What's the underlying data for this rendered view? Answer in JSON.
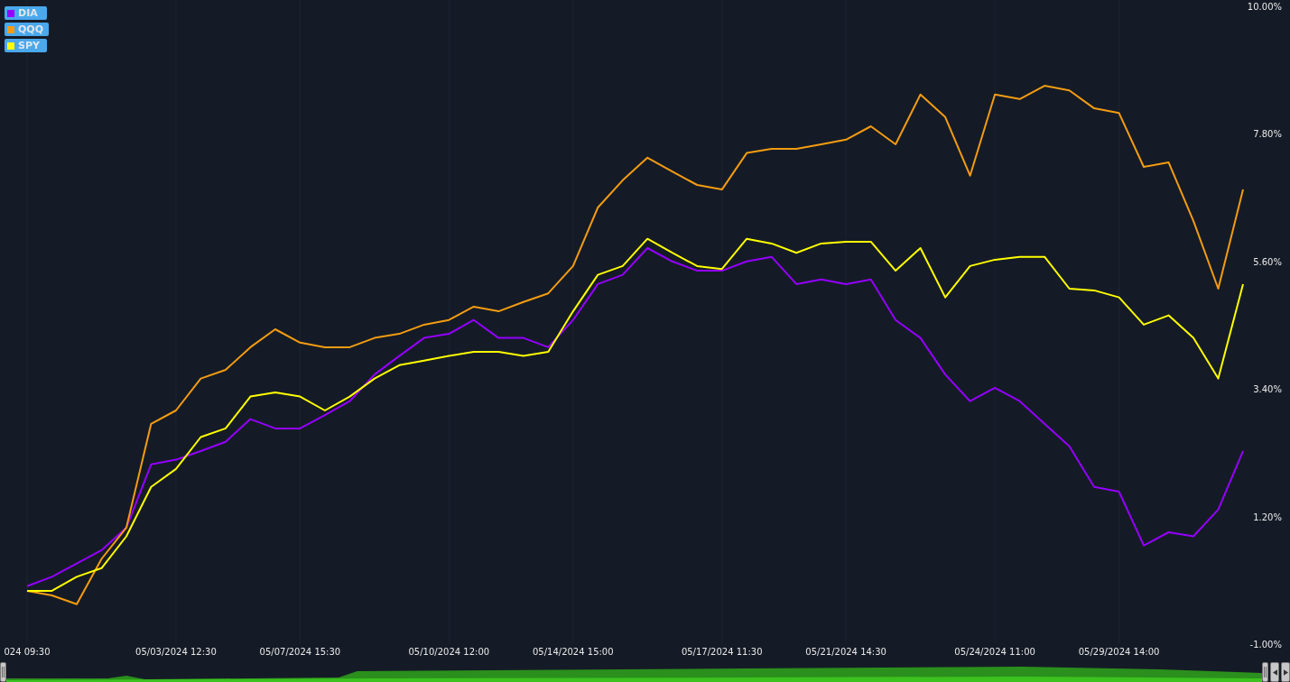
{
  "chart_data": {
    "type": "line",
    "grid": true,
    "ylim": [
      -1,
      10
    ],
    "categories": [
      "024 09:30",
      null,
      null,
      null,
      null,
      null,
      "05/03/2024 12:30",
      null,
      null,
      null,
      null,
      "05/07/2024 15:30",
      null,
      null,
      null,
      null,
      null,
      "05/10/2024 12:00",
      null,
      null,
      null,
      null,
      "05/14/2024 15:00",
      null,
      null,
      null,
      null,
      null,
      "05/17/2024 11:30",
      null,
      null,
      null,
      null,
      "05/21/2024 14:30",
      null,
      null,
      null,
      null,
      null,
      "05/24/2024 11:00",
      null,
      null,
      null,
      null,
      "05/29/2024 14:00",
      null,
      null,
      null,
      null,
      null
    ],
    "yticks": [
      {
        "value": -1,
        "label": "-1.00%"
      },
      {
        "value": 1.2,
        "label": "1.20%"
      },
      {
        "value": 3.4,
        "label": "3.40%"
      },
      {
        "value": 5.6,
        "label": "5.60%"
      },
      {
        "value": 7.8,
        "label": "7.80%"
      },
      {
        "value": 10,
        "label": "10.00%"
      }
    ],
    "series": [
      {
        "name": "DIA",
        "color": "#9400ff",
        "values": [
          0.0,
          0.16,
          0.39,
          0.62,
          1.01,
          2.1,
          2.18,
          2.33,
          2.49,
          2.88,
          2.72,
          2.72,
          2.95,
          3.19,
          3.65,
          3.97,
          4.28,
          4.35,
          4.59,
          4.28,
          4.28,
          4.12,
          4.59,
          5.21,
          5.37,
          5.83,
          5.6,
          5.44,
          5.44,
          5.6,
          5.68,
          5.21,
          5.29,
          5.21,
          5.29,
          4.59,
          4.28,
          3.65,
          3.19,
          3.42,
          3.19,
          2.8,
          2.41,
          1.71,
          1.63,
          0.7,
          0.93,
          0.86,
          1.32,
          2.33
        ]
      },
      {
        "name": "QQQ",
        "color": "#f39c12",
        "values": [
          -0.08,
          -0.16,
          -0.31,
          0.47,
          1.01,
          2.8,
          3.03,
          3.58,
          3.73,
          4.12,
          4.43,
          4.2,
          4.12,
          4.12,
          4.28,
          4.35,
          4.51,
          4.59,
          4.82,
          4.74,
          4.9,
          5.05,
          5.52,
          6.53,
          7.0,
          7.39,
          7.15,
          6.92,
          6.84,
          7.47,
          7.54,
          7.54,
          7.62,
          7.7,
          7.93,
          7.62,
          8.48,
          8.09,
          7.08,
          8.48,
          8.4,
          8.63,
          8.55,
          8.24,
          8.16,
          7.23,
          7.31,
          6.3,
          5.13,
          6.84
        ]
      },
      {
        "name": "SPY",
        "color": "#ffff00",
        "values": [
          -0.08,
          -0.08,
          0.16,
          0.31,
          0.86,
          1.71,
          2.02,
          2.57,
          2.72,
          3.27,
          3.34,
          3.27,
          3.03,
          3.27,
          3.58,
          3.81,
          3.89,
          3.97,
          4.04,
          4.04,
          3.97,
          4.04,
          4.74,
          5.37,
          5.52,
          5.99,
          5.75,
          5.52,
          5.47,
          5.99,
          5.91,
          5.75,
          5.91,
          5.94,
          5.94,
          5.44,
          5.83,
          4.98,
          5.52,
          5.63,
          5.68,
          5.68,
          5.13,
          5.1,
          4.98,
          4.51,
          4.67,
          4.28,
          3.58,
          5.21
        ]
      }
    ]
  }
}
